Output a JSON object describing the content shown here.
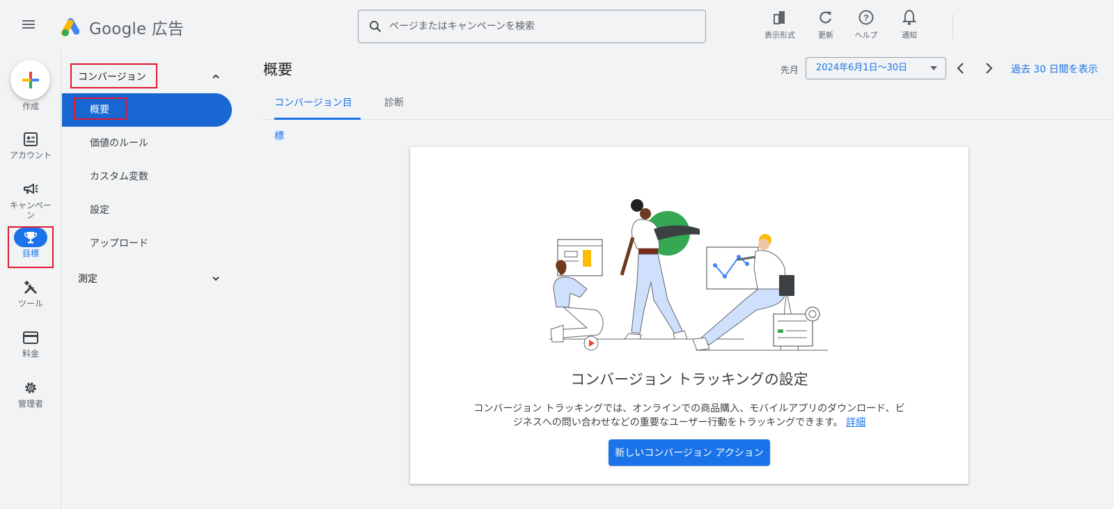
{
  "app": {
    "brand": "Google",
    "product": "広告"
  },
  "search": {
    "placeholder": "ページまたはキャンペーンを検索"
  },
  "header_tools": [
    {
      "label": "表示形式",
      "icon": "appearance-icon"
    },
    {
      "label": "更新",
      "icon": "refresh-icon"
    },
    {
      "label": "ヘルプ",
      "icon": "help-icon"
    },
    {
      "label": "通知",
      "icon": "bell-icon"
    }
  ],
  "rail": {
    "create_label": "作成",
    "items": [
      {
        "label": "アカウント",
        "icon": "account-icon"
      },
      {
        "label": "キャンペーン",
        "icon": "megaphone-icon"
      },
      {
        "label": "目標",
        "icon": "trophy-icon",
        "active": true
      },
      {
        "label": "ツール",
        "icon": "tools-icon"
      },
      {
        "label": "料金",
        "icon": "card-icon"
      },
      {
        "label": "管理者",
        "icon": "gear-icon"
      }
    ]
  },
  "subnav": {
    "section_conversion": "コンバージョン",
    "items": [
      "概要",
      "価値のルール",
      "カスタム変数",
      "設定",
      "アップロード"
    ],
    "active_item": "概要",
    "section_measure": "測定"
  },
  "main": {
    "title": "概要",
    "date_label": "先月",
    "date_range": "2024年6月1日〜30日",
    "last30_link": "過去 30 日間を表示",
    "tabs": [
      "コンバージョン目標",
      "診断"
    ]
  },
  "card": {
    "title": "コンバージョン トラッキングの設定",
    "desc_line1": "コンバージョン トラッキングでは、オンラインでの商品購入、モバイルアプリのダウンロード、ビ",
    "desc_line2": "ジネスへの問い合わせなどの重要なユーザー行動をトラッキングできます。",
    "desc_link": "詳細",
    "button": "新しいコンバージョン アクション"
  },
  "colors": {
    "accent": "#1a73e8",
    "highlight_box": "#e0192f",
    "bg": "#f1f3f4"
  }
}
